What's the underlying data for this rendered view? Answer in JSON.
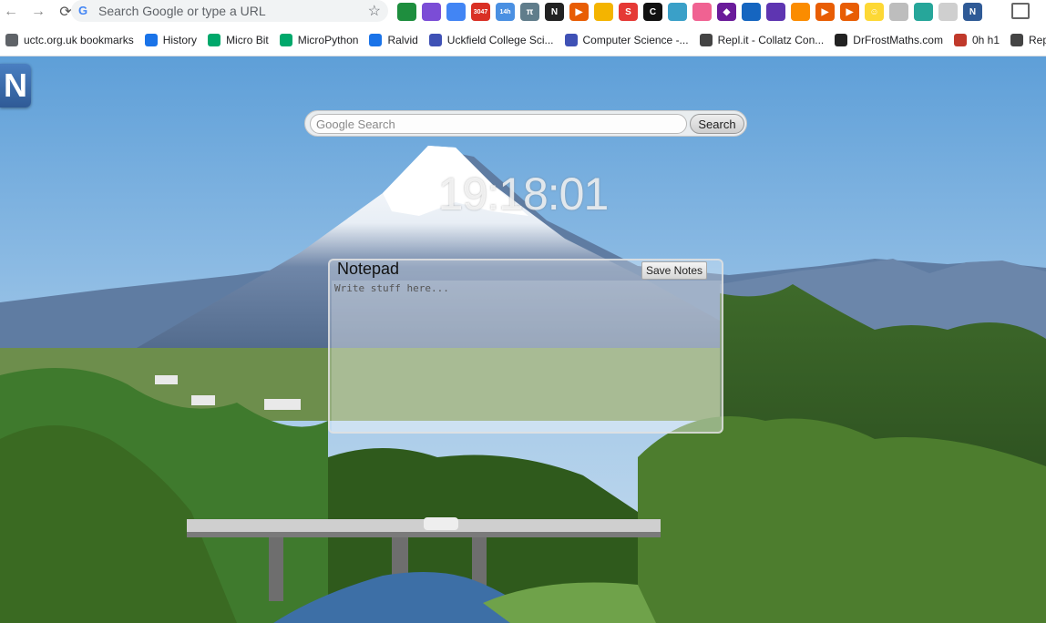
{
  "browser": {
    "omnibox_text": "Search Google or type a URL",
    "extensions": [
      {
        "name": "ext-sheets-icon",
        "color": "#1e8e3e",
        "text": ""
      },
      {
        "name": "ext-puzzle-icon",
        "color": "#7b4dd6",
        "text": ""
      },
      {
        "name": "ext-translate-icon",
        "color": "#4285f4",
        "text": ""
      },
      {
        "name": "ext-gmail-icon",
        "color": "#d93025",
        "text": "3047"
      },
      {
        "name": "ext-calendar-icon",
        "color": "#4a90e2",
        "text": "14h"
      },
      {
        "name": "ext-pi-icon",
        "color": "#607d8b",
        "text": "π"
      },
      {
        "name": "ext-notion-icon",
        "color": "#222222",
        "text": "N"
      },
      {
        "name": "ext-play-icon",
        "color": "#e85d04",
        "text": "▶"
      },
      {
        "name": "ext-photo-icon",
        "color": "#f4b400",
        "text": ""
      },
      {
        "name": "ext-s-icon",
        "color": "#e53935",
        "text": "S"
      },
      {
        "name": "ext-c-icon",
        "color": "#111111",
        "text": "C"
      },
      {
        "name": "ext-eye-icon",
        "color": "#3aa0c8",
        "text": ""
      },
      {
        "name": "ext-dots-icon",
        "color": "#f06292",
        "text": ""
      },
      {
        "name": "ext-diamond-icon",
        "color": "#6a1b9a",
        "text": "◆"
      },
      {
        "name": "ext-monitor-icon",
        "color": "#1565c0",
        "text": ""
      },
      {
        "name": "ext-cube-icon",
        "color": "#5e35b1",
        "text": ""
      },
      {
        "name": "ext-orange-icon",
        "color": "#fb8c00",
        "text": ""
      },
      {
        "name": "ext-play2-icon",
        "color": "#e85d04",
        "text": "▶"
      },
      {
        "name": "ext-play3-icon",
        "color": "#e85d04",
        "text": "▶"
      },
      {
        "name": "ext-smiley-icon",
        "color": "#fdd835",
        "text": "☺"
      },
      {
        "name": "ext-grey-icon",
        "color": "#bdbdbd",
        "text": ""
      },
      {
        "name": "ext-map-icon",
        "color": "#26a69a",
        "text": ""
      },
      {
        "name": "ext-grey2-icon",
        "color": "#cfcfcf",
        "text": ""
      },
      {
        "name": "ext-n-icon",
        "color": "#2f5a96",
        "text": "N"
      }
    ],
    "bookmarks": [
      {
        "label": "uctc.org.uk bookmarks",
        "icon": "folder-icon",
        "color": "#5f6368"
      },
      {
        "label": "History",
        "icon": "history-icon",
        "color": "#1a73e8"
      },
      {
        "label": "Micro Bit",
        "icon": "microbit-icon",
        "color": "#00a86b"
      },
      {
        "label": "MicroPython",
        "icon": "micropython-icon",
        "color": "#00a86b"
      },
      {
        "label": "Ralvid",
        "icon": "ralvid-icon",
        "color": "#1a73e8"
      },
      {
        "label": "Uckfield College Sci...",
        "icon": "uckfield-icon",
        "color": "#3f51b5"
      },
      {
        "label": "Computer Science -...",
        "icon": "compsci-icon",
        "color": "#3f51b5"
      },
      {
        "label": "Repl.it - Collatz Con...",
        "icon": "replit-icon",
        "color": "#444444"
      },
      {
        "label": "DrFrostMaths.com",
        "icon": "drfrost-icon",
        "color": "#222222"
      },
      {
        "label": "0h h1",
        "icon": "ohh1-icon",
        "color": "#c0392b"
      },
      {
        "label": "Repl.it - Treeple",
        "icon": "replit2-icon",
        "color": "#444444"
      }
    ]
  },
  "page": {
    "logo_letter": "N",
    "search": {
      "placeholder": "Google Search",
      "button_label": "Search"
    },
    "clock": "19:18:01",
    "notepad": {
      "title": "Notepad",
      "save_label": "Save Notes",
      "placeholder": "Write stuff here..."
    }
  }
}
